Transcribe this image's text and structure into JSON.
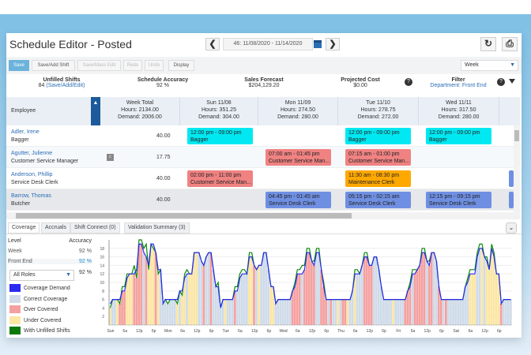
{
  "header": {
    "title": "Schedule Editor - Posted",
    "date_range": "46: 11/08/2020 - 11/14/2020",
    "prev": "❮",
    "next": "❯",
    "refresh_icon": "↻",
    "print_icon": "⎙"
  },
  "toolbar": {
    "save": "Save",
    "save_add_shift": "Save/Add Shift",
    "save_mass_edit": "Save/Mass Edit",
    "redo": "Redo",
    "undo": "Undo",
    "display": "Display",
    "view_select": "Week"
  },
  "summary": {
    "unfilled_label": "Unfilled Shifts",
    "unfilled_count": "84",
    "unfilled_link": "(Save/Add/Edit)",
    "accuracy_label": "Schedule Accuracy",
    "accuracy_value": "92 %",
    "sales_label": "Sales Forecast",
    "sales_value": "$204,129.20",
    "cost_label": "Projected Cost",
    "cost_value": "$0.00",
    "filter_label": "Filter",
    "filter_value": "Department: Front End"
  },
  "grid": {
    "employee_header": "Employee",
    "columns": [
      {
        "day": "Week Total",
        "hours": "Hours: 2134.00",
        "demand": "Demand: 2006.00"
      },
      {
        "day": "Sun 11/08",
        "hours": "Hours: 351.25",
        "demand": "Demand: 304.00"
      },
      {
        "day": "Mon 11/09",
        "hours": "Hours: 274.50",
        "demand": "Demand: 280.00"
      },
      {
        "day": "Tue 11/10",
        "hours": "Hours: 278.75",
        "demand": "Demand: 272.00"
      },
      {
        "day": "Wed 11/11",
        "hours": "Hours: 317.50",
        "demand": "Demand: 280.00"
      }
    ],
    "rows": [
      {
        "name": "Adler, Irene",
        "role": "Bagger",
        "total": "40.00",
        "shifts": [
          {
            "day": 1,
            "time": "12:00 pm - 09:00 pm",
            "role": "Bagger",
            "color": "#00e8f2"
          },
          {
            "day": 3,
            "time": "12:00 pm - 09:00 pm",
            "role": "Bagger",
            "color": "#00e8f2"
          },
          {
            "day": 4,
            "time": "12:00 pm - 09:00 pm",
            "role": "Bagger",
            "color": "#00e8f2"
          }
        ]
      },
      {
        "name": "Agutter, Julienne",
        "role": "Customer Service Manager",
        "total": "17.75",
        "badge": "c",
        "shifts": [
          {
            "day": 2,
            "time": "07:00 am - 01:45 pm",
            "role": "Customer Service Man...",
            "color": "#f08282"
          },
          {
            "day": 3,
            "time": "07:15 am - 01:00 pm",
            "role": "Customer Service Man...",
            "color": "#f08282"
          }
        ]
      },
      {
        "name": "Anderson, Phillip",
        "role": "Service Desk Clerk",
        "total": "40.00",
        "shifts": [
          {
            "day": 1,
            "time": "02:00 pm - 11:00 pm",
            "role": "Customer Service Man...",
            "color": "#f08282"
          },
          {
            "day": 3,
            "time": "11:30 am - 08:30 pm",
            "role": "Maintenance Clerk",
            "color": "#ffa800"
          }
        ]
      },
      {
        "name": "Barrow, Thomas",
        "role": "Butcher",
        "total": "40.00",
        "shifts": [
          {
            "day": 2,
            "time": "04:45 pm - 01:45 am",
            "role": "Service Desk Clerk",
            "color": "#6f8fe2"
          },
          {
            "day": 3,
            "time": "05:15 pm - 02:15 am",
            "role": "Service Desk Clerk",
            "color": "#6f8fe2"
          },
          {
            "day": 4,
            "time": "12:15 pm - 09:15 pm",
            "role": "Service Desk Clerk",
            "color": "#6f8fe2"
          }
        ]
      }
    ]
  },
  "tabs": [
    "Coverage",
    "Accruals",
    "Shift Connect (0)",
    "Validation Summary (3)"
  ],
  "coverage_panel": {
    "level_header": "Level",
    "accuracy_header": "Accuracy",
    "levels": [
      {
        "name": "Week",
        "value": "92 %"
      },
      {
        "name": "Front End",
        "value": "92 %"
      }
    ],
    "roles_select": "All Roles",
    "roles_value": "92 %",
    "legend": [
      {
        "label": "Coverage Demand",
        "color": "#2a2af0"
      },
      {
        "label": "Correct Coverage",
        "color": "#cfdbe9"
      },
      {
        "label": "Over Covered",
        "color": "#f5a0a0"
      },
      {
        "label": "Under Covered",
        "color": "#fbe6a4"
      },
      {
        "label": "With Unfilled Shifts",
        "color": "#0a7a0a"
      }
    ]
  },
  "chart_data": {
    "type": "area",
    "ylim": [
      0,
      20
    ],
    "yticks": [
      2,
      4,
      6,
      8,
      10,
      12,
      14,
      16,
      18
    ],
    "xticks": [
      "Sun",
      "6a",
      "12p",
      "6p",
      "Mon",
      "6a",
      "12p",
      "6p",
      "Tue",
      "6a",
      "12p",
      "6p",
      "Wed",
      "6a",
      "12p",
      "6p",
      "Thu",
      "6a",
      "12p",
      "6p",
      "Fri",
      "6a",
      "12p",
      "6p",
      "Sat",
      "6a",
      "12p",
      "6p"
    ],
    "demand": [
      5,
      6,
      6,
      6,
      6,
      8,
      8,
      11,
      12,
      12,
      12,
      13,
      19,
      19,
      17,
      16,
      14,
      19,
      19,
      17,
      13,
      13,
      5,
      6,
      6,
      6,
      6,
      6,
      6,
      8,
      8,
      11,
      12,
      12,
      12,
      17,
      17,
      17,
      15,
      14,
      16,
      17,
      17,
      13,
      9,
      9,
      4,
      6,
      6,
      6,
      6,
      6,
      8,
      8,
      11,
      12,
      12,
      12,
      16,
      16,
      14,
      13,
      14,
      14,
      17,
      17,
      13,
      9,
      9,
      5,
      6,
      6,
      6,
      6,
      6,
      6,
      8,
      9,
      12,
      12,
      12,
      13,
      17,
      17,
      15,
      14,
      17,
      17,
      13,
      9,
      6,
      6,
      6,
      6,
      6,
      6,
      6,
      6,
      6,
      6,
      6,
      8,
      12,
      12,
      12,
      14,
      16,
      16,
      14,
      14,
      16,
      16,
      13,
      9,
      6,
      6,
      6,
      6,
      6,
      6,
      6,
      6,
      6,
      6,
      8,
      9,
      12,
      12,
      13,
      14,
      17,
      17,
      15,
      14,
      17,
      17,
      15,
      9,
      6,
      6,
      6,
      6,
      6,
      6,
      6,
      6,
      6,
      6,
      9,
      10,
      12,
      12,
      12,
      16,
      18,
      18,
      16,
      15,
      13,
      18,
      16,
      12,
      12,
      5,
      6,
      6,
      6,
      6
    ],
    "scheduled": [
      4,
      6,
      6,
      6,
      5,
      9,
      9,
      12,
      12,
      12,
      14,
      11,
      20,
      20,
      18,
      19,
      13,
      19,
      18,
      17,
      12,
      13,
      5,
      6,
      5,
      6,
      6,
      6,
      5,
      8,
      7,
      12,
      13,
      12,
      12,
      17,
      17,
      17,
      15,
      14,
      16,
      17,
      17,
      13,
      9,
      10,
      4,
      6,
      6,
      6,
      6,
      6,
      9,
      9,
      12,
      13,
      13,
      12,
      17,
      17,
      14,
      13,
      14,
      14,
      17,
      17,
      13,
      9,
      9,
      5,
      6,
      6,
      6,
      6,
      6,
      6,
      8,
      10,
      13,
      13,
      14,
      14,
      18,
      18,
      15,
      15,
      18,
      18,
      13,
      10,
      6,
      6,
      6,
      6,
      6,
      6,
      6,
      6,
      6,
      6,
      6,
      8,
      13,
      13,
      12,
      14,
      17,
      17,
      14,
      14,
      16,
      16,
      13,
      9,
      6,
      6,
      6,
      6,
      6,
      6,
      6,
      6,
      6,
      6,
      8,
      10,
      13,
      13,
      13,
      14,
      18,
      18,
      15,
      15,
      17,
      17,
      15,
      9,
      6,
      6,
      6,
      6,
      6,
      6,
      6,
      6,
      6,
      6,
      9,
      11,
      13,
      13,
      13,
      17,
      19,
      19,
      16,
      16,
      13,
      19,
      17,
      12,
      12,
      5,
      6,
      6,
      6,
      6
    ],
    "status": "UCCUOOOUUUOOOOCOUUUOUCCC CCCCUCUUCUUUUCCOCCOCCCCC UCCCOCCCCCUUOCUCCCCUUCCC CCCCOOOOCOOOOOCCOOOCOCCU COOUCCUCCCOOOOCCCCCCCCUC CCCOOOCOOOOOCOOCCOOCOCCC CCCCCCUUUCCUCUUUUUUOCCCC"
  }
}
